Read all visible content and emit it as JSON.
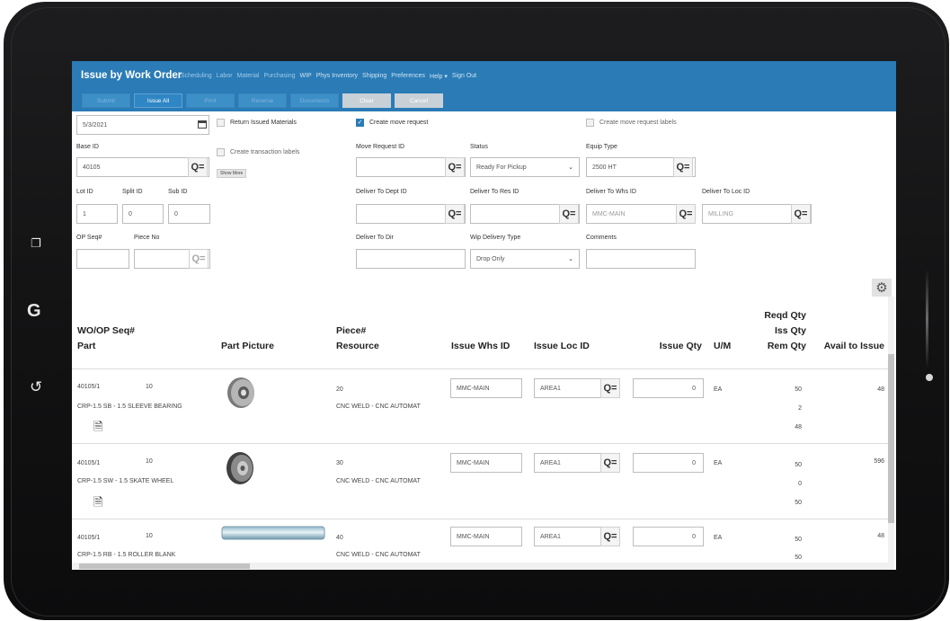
{
  "navbar": {
    "title": "Issue by Work Order",
    "links": [
      "Scheduling",
      "Labor",
      "Material",
      "Purchasing",
      "WIP",
      "Phys Inventory",
      "Shipping",
      "Preferences",
      "Help ▾",
      "Sign Out"
    ],
    "buttons": [
      "Submit",
      "Issue All",
      "Print",
      "Reverse",
      "Documents",
      "Clear",
      "Cancel"
    ]
  },
  "form": {
    "date": "5/3/2021",
    "return_issued": "Return Issued Materials",
    "create_trans_labels": "Create transaction labels",
    "show_more": "Show More",
    "create_move_request": "Create move request",
    "create_move_labels": "Create move request labels",
    "base_id_label": "Base ID",
    "base_id": "40105",
    "lot_id_label": "Lot ID",
    "lot_id": "1",
    "split_id_label": "Split ID",
    "split_id": "0",
    "sub_id_label": "Sub ID",
    "sub_id": "0",
    "op_seq_label": "OP Seq#",
    "piece_no_label": "Piece No",
    "move_request_id_label": "Move Request ID",
    "status_label": "Status",
    "status": "Ready For Pickup",
    "equip_type_label": "Equip Type",
    "equip_type": "2500 HT",
    "deliver_dept_label": "Deliver To Dept ID",
    "deliver_res_label": "Deliver To Res ID",
    "deliver_whs_label": "Deliver To Whs ID",
    "deliver_whs": "MMC-MAIN",
    "deliver_loc_label": "Deliver To Loc ID",
    "deliver_loc": "MILLING",
    "deliver_dir_label": "Deliver To Dir",
    "wip_delivery_label": "Wip Delivery Type",
    "wip_delivery": "Drop Only",
    "comments_label": "Comments"
  },
  "grid": {
    "headers": {
      "wo_op": "WO/OP Seq#",
      "part": "Part",
      "picture": "Part Picture",
      "piece": "Piece#",
      "resource": "Resource",
      "whs": "Issue Whs ID",
      "loc": "Issue Loc ID",
      "qty": "Issue Qty",
      "um": "U/M",
      "reqd": "Reqd Qty",
      "iss": "Iss Qty",
      "rem": "Rem Qty",
      "avail": "Avail to Issue"
    },
    "rows": [
      {
        "wo": "40105/1",
        "seq": "10",
        "part": "CRP-1.5 SB - 1.5 SLEEVE BEARING",
        "piece": "20",
        "resource": "CNC WELD - CNC AUTOMAT",
        "whs": "MMC-MAIN",
        "loc": "AREA1",
        "qty": "0",
        "um": "EA",
        "reqd": "50",
        "iss": "2",
        "rem": "48",
        "avail": "48"
      },
      {
        "wo": "40105/1",
        "seq": "10",
        "part": "CRP-1.5 SW - 1.5 SKATE WHEEL",
        "piece": "30",
        "resource": "CNC WELD - CNC AUTOMAT",
        "whs": "MMC-MAIN",
        "loc": "AREA1",
        "qty": "0",
        "um": "EA",
        "reqd": "50",
        "iss": "0",
        "rem": "50",
        "avail": "596"
      },
      {
        "wo": "40105/1",
        "seq": "10",
        "part": "CRP-1.5 RB - 1.5 ROLLER BLANK",
        "piece": "40",
        "resource": "CNC WELD - CNC AUTOMAT",
        "whs": "MMC-MAIN",
        "loc": "AREA1",
        "qty": "0",
        "um": "EA",
        "reqd": "50",
        "iss": "50",
        "rem": "",
        "avail": "48"
      }
    ]
  },
  "icons": {
    "lookup": "search-filter-icon",
    "gear": "gear-icon",
    "document": "document-icon",
    "calendar": "calendar-icon"
  },
  "colors": {
    "navbar": "#2a7bb6",
    "accent": "#2a7bb6"
  }
}
